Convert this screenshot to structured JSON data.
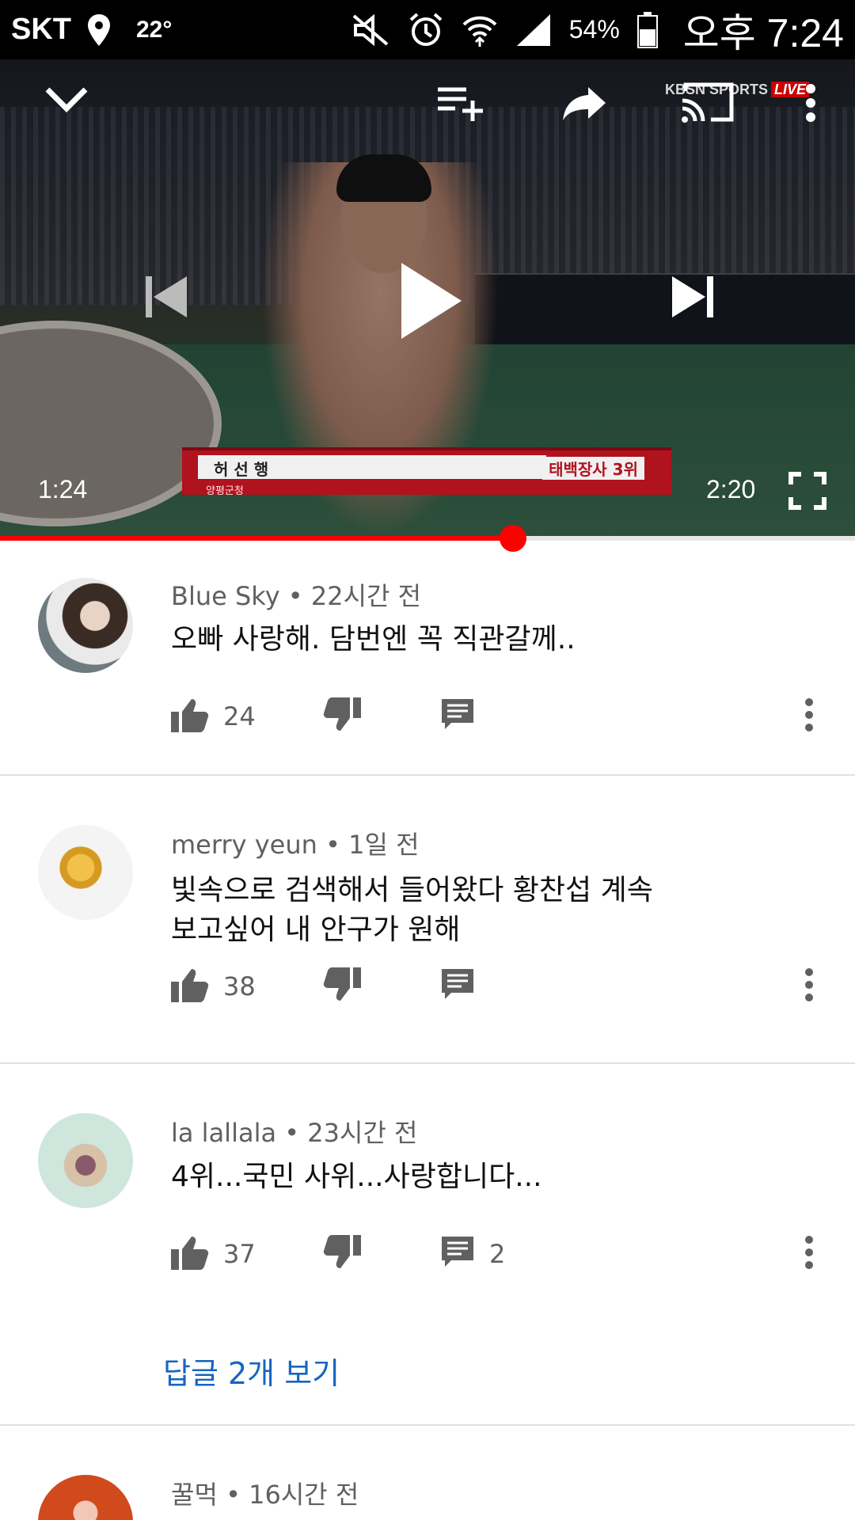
{
  "status_bar": {
    "carrier": "SKT",
    "temperature": "22°",
    "battery_percent": "54%",
    "time": "오후 7:24"
  },
  "player": {
    "broadcaster": "KBSN SPORTS",
    "live_badge": "LIVE",
    "caption_name": "허 선 행",
    "caption_rank": "태백장사 3위",
    "caption_sub": "양평군청",
    "elapsed": "1:24",
    "duration": "2:20",
    "progress": 0.6,
    "icons": {
      "collapse": "chevron-down-icon",
      "add_to_playlist": "playlist-add-icon",
      "share": "share-icon",
      "cast": "cast-icon",
      "more": "more-vert-icon",
      "previous": "skip-previous-icon",
      "play": "play-icon",
      "next": "skip-next-icon",
      "fullscreen": "fullscreen-icon"
    }
  },
  "comments": [
    {
      "author": "Blue Sky",
      "time": "22시간 전",
      "text": "오빠 사랑해. 담번엔 꼭 직관갈께..",
      "likes": "24",
      "replies": ""
    },
    {
      "author": "merry yeun",
      "time": "1일 전",
      "text_line1": "빛속으로 검색해서 들어왔다 황찬섭 계속",
      "text_line2": "보고싶어 내 안구가 원해",
      "likes": "38",
      "replies": ""
    },
    {
      "author": "la lallala",
      "time": "23시간 전",
      "text": "4위...국민 사위...사랑합니다...",
      "likes": "37",
      "replies": "2",
      "view_replies": "답글 2개 보기"
    },
    {
      "author": "꿀먹",
      "time": "16시간 전"
    }
  ],
  "separator": "•",
  "colors": {
    "progress": "#ff0000",
    "link": "#1565c0"
  }
}
